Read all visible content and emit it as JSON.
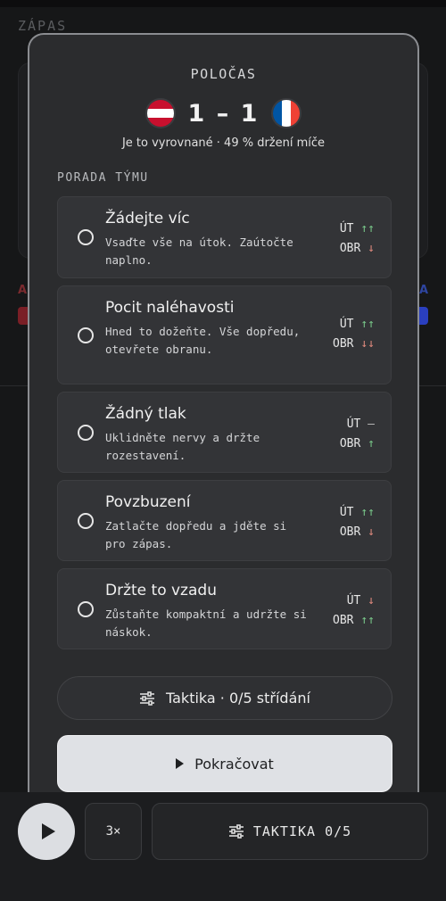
{
  "background": {
    "title": "ZÁPAS",
    "home_abbr": "A",
    "away_abbr": "A"
  },
  "halftime": {
    "label": "POLOČAS",
    "home_score": "1",
    "separator": "–",
    "away_score": "1",
    "summary": "Je to vyrovnané · 49 % držení míče"
  },
  "team_talk": {
    "label": "PORADA TÝMU",
    "options": [
      {
        "title": "Žádejte víc",
        "desc": "Vsaďte vše na útok. Zaútočte naplno.",
        "att_label": "ÚT",
        "att_effect": "↑↑",
        "def_label": "OBR",
        "def_effect": "↓"
      },
      {
        "title": "Pocit naléhavosti",
        "desc": "Hned to dožeňte. Vše dopředu, otevřete obranu.",
        "att_label": "ÚT",
        "att_effect": "↑↑",
        "def_label": "OBR",
        "def_effect": "↓↓"
      },
      {
        "title": "Žádný tlak",
        "desc": "Uklidněte nervy a držte rozestavení.",
        "att_label": "ÚT",
        "att_effect": "–",
        "def_label": "OBR",
        "def_effect": "↑"
      },
      {
        "title": "Povzbuzení",
        "desc": "Zatlačte dopředu a jděte si pro zápas.",
        "att_label": "ÚT",
        "att_effect": "↑↑",
        "def_label": "OBR",
        "def_effect": "↓"
      },
      {
        "title": "Držte to vzadu",
        "desc": "Zůstaňte kompaktní a udržte si náskok.",
        "att_label": "ÚT",
        "att_effect": "↓",
        "def_label": "OBR",
        "def_effect": "↑↑"
      }
    ]
  },
  "buttons": {
    "tactics_label": "Taktika · 0/5 střídání",
    "continue_label": "Pokračovat"
  },
  "bottom_bar": {
    "speed_label": "3×",
    "tactics_label": "TAKTIKA 0/5"
  },
  "colors": {
    "up": "#79c88a",
    "down": "#e08a7e",
    "austria_red": "#c8102e",
    "france_blue": "#0055a4"
  },
  "icons": {
    "home_flag": "austria-flag-icon",
    "away_flag": "france-flag-icon",
    "tactics": "sliders-icon",
    "continue": "play-icon"
  }
}
